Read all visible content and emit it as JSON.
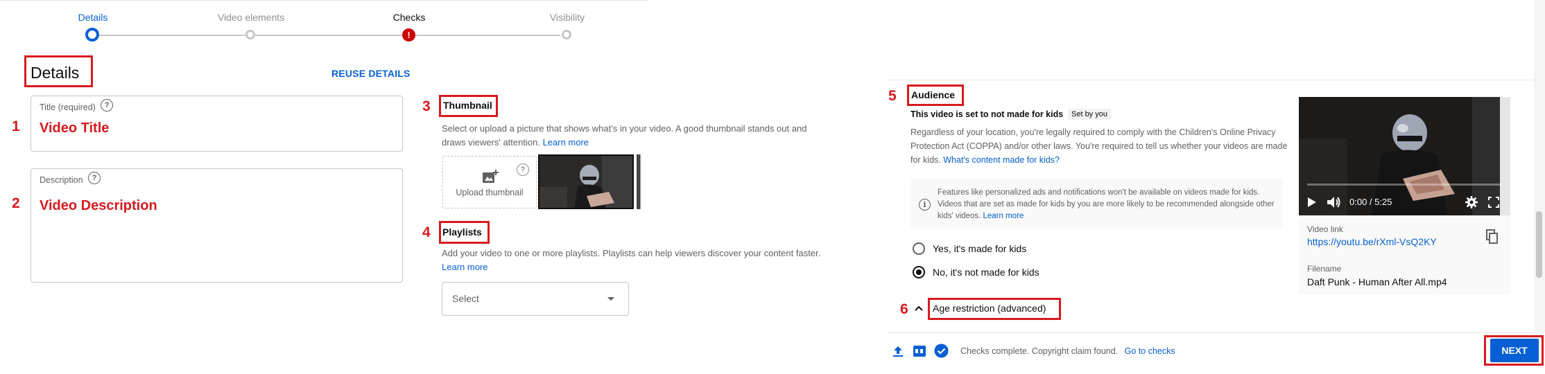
{
  "stepper": {
    "steps": [
      {
        "label": "Details",
        "state": "active"
      },
      {
        "label": "Video elements",
        "state": "todo"
      },
      {
        "label": "Checks",
        "state": "error"
      },
      {
        "label": "Visibility",
        "state": "todo"
      }
    ],
    "error_glyph": "!"
  },
  "details": {
    "heading": "Details",
    "reuse_label": "REUSE DETAILS",
    "title_label": "Title (required)",
    "title_annotation": "Video Title",
    "description_label": "Description",
    "description_annotation": "Video Description",
    "help_glyph": "?"
  },
  "thumbnail": {
    "heading": "Thumbnail",
    "description": "Select or upload a picture that shows what's in your video. A good thumbnail stands out and draws viewers' attention.",
    "learn_more": "Learn more",
    "upload_label": "Upload thumbnail"
  },
  "playlists": {
    "heading": "Playlists",
    "description": "Add your video to one or more playlists. Playlists can help viewers discover your content faster.",
    "learn_more": "Learn more",
    "select_value": "Select"
  },
  "annotations": {
    "n1": "1",
    "n2": "2",
    "n3": "3",
    "n4": "4",
    "n5": "5",
    "n6": "6"
  },
  "audience": {
    "heading": "Audience",
    "status": "This video is set to not made for kids",
    "set_by": "Set by you",
    "description": "Regardless of your location, you're legally required to comply with the Children's Online Privacy Protection Act (COPPA) and/or other laws. You're required to tell us whether your videos are made for kids.",
    "whats_link": "What's content made for kids?",
    "info": "Features like personalized ads and notifications won't be available on videos made for kids. Videos that are set as made for kids by you are more likely to be recommended alongside other kids' videos.",
    "info_link": "Learn more",
    "option_yes": "Yes, it's made for kids",
    "option_no": "No, it's not made for kids",
    "selected": "no"
  },
  "age_restriction": {
    "heading": "Age restriction (advanced)"
  },
  "video": {
    "time": "0:00 / 5:25",
    "link_label": "Video link",
    "link": "https://youtu.be/rXml-VsQ2KY",
    "filename_label": "Filename",
    "filename": "Daft Punk - Human After All.mp4"
  },
  "footer": {
    "status": "Checks complete. Copyright claim found.",
    "goto": "Go to checks",
    "next_label": "NEXT"
  },
  "colors": {
    "accent": "#065fd4",
    "annotation_red": "#d7191f",
    "error": "#cc0000"
  }
}
